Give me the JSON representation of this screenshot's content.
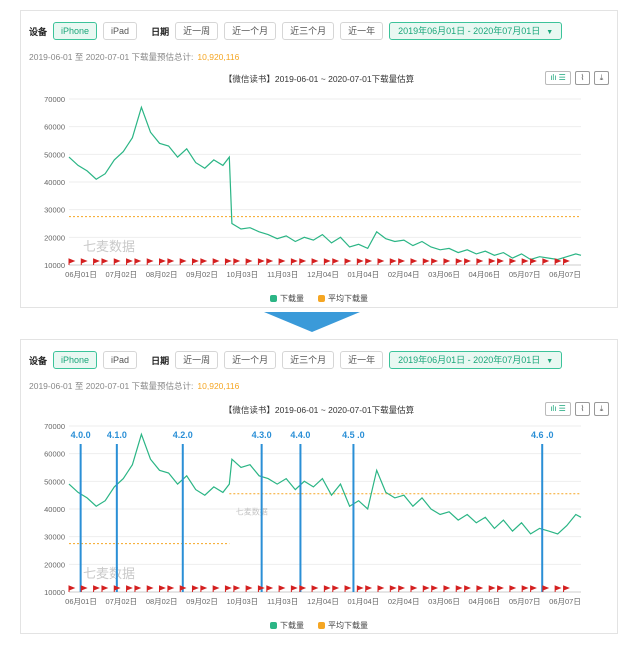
{
  "toolbar": {
    "device_label": "设备",
    "device_options": [
      "iPhone",
      "iPad"
    ],
    "date_label": "日期",
    "quick_ranges": [
      "近一周",
      "近一个月",
      "近三个月",
      "近一年"
    ],
    "date_range": "2019年06月01日 - 2020年07月01日"
  },
  "summary": {
    "text": "2019-06-01 至 2020-07-01 下载量预估总计:",
    "total": "10,920,116"
  },
  "chart_title": "【微信读书】2019-06-01 ~ 2020-07-01下载量估算",
  "watermark": "七麦数据",
  "colors": {
    "downloads": "#2bb585",
    "average": "#f5a623",
    "version": "#2a8fd6",
    "event": "#d42020"
  },
  "chart_data": [
    {
      "type": "line",
      "title": "【微信读书】2019-06-01 ~ 2020-07-01下载量估算",
      "ylim": [
        10000,
        70000
      ],
      "yticks": [
        10000,
        20000,
        30000,
        40000,
        50000,
        60000,
        70000
      ],
      "x_ticks": [
        "06月01日",
        "07月02日",
        "08月02日",
        "09月02日",
        "10月03日",
        "11月03日",
        "12月04日",
        "01月04日",
        "02月04日",
        "03月06日",
        "04月06日",
        "05月07日",
        "06月07日"
      ],
      "series": [
        {
          "name": "下载量",
          "x": [
            "2019-06-01",
            "2019-06-08",
            "2019-06-15",
            "2019-06-22",
            "2019-06-29",
            "2019-07-06",
            "2019-07-13",
            "2019-07-20",
            "2019-07-27",
            "2019-08-03",
            "2019-08-10",
            "2019-08-17",
            "2019-08-24",
            "2019-08-31",
            "2019-09-07",
            "2019-09-14",
            "2019-09-21",
            "2019-09-28",
            "2019-10-03",
            "2019-10-05",
            "2019-10-12",
            "2019-10-19",
            "2019-10-26",
            "2019-11-02",
            "2019-11-09",
            "2019-11-16",
            "2019-11-23",
            "2019-11-30",
            "2019-12-07",
            "2019-12-14",
            "2019-12-21",
            "2019-12-28",
            "2020-01-04",
            "2020-01-11",
            "2020-01-18",
            "2020-01-25",
            "2020-02-01",
            "2020-02-08",
            "2020-02-15",
            "2020-02-22",
            "2020-02-29",
            "2020-03-07",
            "2020-03-14",
            "2020-03-21",
            "2020-03-28",
            "2020-04-04",
            "2020-04-11",
            "2020-04-18",
            "2020-04-25",
            "2020-05-02",
            "2020-05-09",
            "2020-05-16",
            "2020-05-23",
            "2020-05-30",
            "2020-06-06",
            "2020-06-13",
            "2020-06-20",
            "2020-06-27",
            "2020-07-01"
          ],
          "values": [
            49000,
            46000,
            44000,
            41000,
            43000,
            48000,
            51000,
            56000,
            67000,
            58000,
            54000,
            53000,
            49000,
            52000,
            47000,
            45000,
            48000,
            46000,
            49000,
            25000,
            23000,
            23500,
            22000,
            21000,
            19500,
            20500,
            18500,
            20000,
            19000,
            21000,
            18000,
            20000,
            16500,
            17500,
            16000,
            22000,
            19500,
            18500,
            19000,
            17000,
            18500,
            16500,
            15500,
            16000,
            14500,
            15500,
            14000,
            15000,
            13500,
            14500,
            12500,
            14000,
            12000,
            13000,
            12500,
            12000,
            13000,
            14000,
            13500
          ]
        },
        {
          "name": "平均下载量",
          "values": [
            27500
          ]
        }
      ],
      "legend": "bottom-center",
      "grid": true
    },
    {
      "type": "line",
      "title": "【微信读书】2019-06-01 ~ 2020-07-01下载量估算",
      "ylim": [
        10000,
        70000
      ],
      "yticks": [
        10000,
        20000,
        30000,
        40000,
        50000,
        60000,
        70000
      ],
      "x_ticks": [
        "06月01日",
        "07月02日",
        "08月02日",
        "09月02日",
        "10月03日",
        "11月03日",
        "12月04日",
        "01月04日",
        "02月04日",
        "03月06日",
        "04月06日",
        "05月07日",
        "06月07日"
      ],
      "series": [
        {
          "name": "下载量",
          "x": [
            "2019-06-01",
            "2019-06-08",
            "2019-06-15",
            "2019-06-22",
            "2019-06-29",
            "2019-07-06",
            "2019-07-13",
            "2019-07-20",
            "2019-07-27",
            "2019-08-03",
            "2019-08-10",
            "2019-08-17",
            "2019-08-24",
            "2019-08-31",
            "2019-09-07",
            "2019-09-14",
            "2019-09-21",
            "2019-09-28",
            "2019-10-03",
            "2019-10-05",
            "2019-10-12",
            "2019-10-19",
            "2019-10-26",
            "2019-11-02",
            "2019-11-09",
            "2019-11-16",
            "2019-11-23",
            "2019-11-30",
            "2019-12-07",
            "2019-12-14",
            "2019-12-21",
            "2019-12-28",
            "2020-01-04",
            "2020-01-11",
            "2020-01-18",
            "2020-01-25",
            "2020-02-01",
            "2020-02-08",
            "2020-02-15",
            "2020-02-22",
            "2020-02-29",
            "2020-03-07",
            "2020-03-14",
            "2020-03-21",
            "2020-03-28",
            "2020-04-04",
            "2020-04-11",
            "2020-04-18",
            "2020-04-25",
            "2020-05-02",
            "2020-05-09",
            "2020-05-16",
            "2020-05-23",
            "2020-05-30",
            "2020-06-06",
            "2020-06-13",
            "2020-06-20",
            "2020-06-27",
            "2020-07-01"
          ],
          "values": [
            49000,
            46000,
            44000,
            41000,
            43000,
            48000,
            51000,
            56000,
            67000,
            58000,
            54000,
            53000,
            49000,
            52000,
            47000,
            45000,
            48000,
            46000,
            49000,
            58000,
            55000,
            56000,
            52000,
            51000,
            49000,
            51000,
            47000,
            50000,
            48000,
            51000,
            45000,
            49000,
            41000,
            43000,
            40000,
            54000,
            46000,
            44000,
            45000,
            41000,
            44000,
            40000,
            38000,
            39000,
            36000,
            38000,
            35000,
            37000,
            33000,
            36000,
            32000,
            35000,
            31000,
            33000,
            32000,
            31000,
            34000,
            38000,
            37000
          ]
        },
        {
          "name": "平均下载量",
          "values": [
            27500
          ]
        },
        {
          "name": "平均下载量",
          "values": [
            45500
          ]
        }
      ],
      "versions": [
        {
          "label": "4.0.0",
          "x": "2019-06-10"
        },
        {
          "label": "4.1.0",
          "x": "2019-07-08"
        },
        {
          "label": "4.2.0",
          "x": "2019-08-28"
        },
        {
          "label": "4.3.0",
          "x": "2019-10-28"
        },
        {
          "label": "4.4.0",
          "x": "2019-11-27"
        },
        {
          "label": "4.5 .0",
          "x": "2020-01-07"
        },
        {
          "label": "4.6 .0",
          "x": "2020-06-01"
        }
      ],
      "legend": "bottom-center",
      "grid": true
    }
  ],
  "legend": {
    "downloads": "下载量",
    "average": "平均下载量"
  }
}
